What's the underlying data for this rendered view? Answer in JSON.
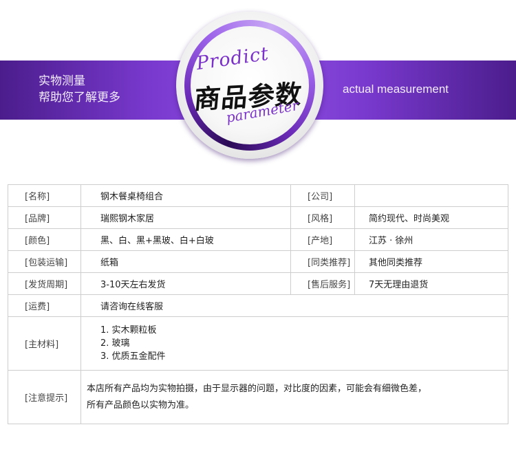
{
  "banner": {
    "left_line1": "实物测量",
    "left_line2": "帮助您了解更多",
    "right_text": "actual measurement",
    "badge_en_top": "Prodict",
    "badge_cn": "商品参数",
    "badge_en_bottom": "parameter"
  },
  "params": {
    "rows": [
      {
        "l1": "[名称]",
        "v1": "钢木餐桌椅组合",
        "l2": "[公司]",
        "v2": ""
      },
      {
        "l1": "[品牌]",
        "v1": "瑞熙钢木家居",
        "l2": "[风格]",
        "v2": "简约现代、时尚美观"
      },
      {
        "l1": "[颜色]",
        "v1": "黑、白、黑+黑玻、白+白玻",
        "l2": "[产地]",
        "v2": "江苏 · 徐州"
      },
      {
        "l1": "[包装运输]",
        "v1": "纸箱",
        "l2": "[同类推荐]",
        "v2": "其他同类推荐"
      },
      {
        "l1": "[发货周期]",
        "v1": "3-10天左右发货",
        "l2": "[售后服务]",
        "v2": "7天无理由退货"
      }
    ],
    "shipping": {
      "label": "[运费]",
      "value": "请咨询在线客服"
    },
    "material": {
      "label": "[主材料]",
      "items": [
        "1. 实木颗粒板",
        "2. 玻璃",
        "3. 优质五金配件"
      ]
    },
    "notice": {
      "label": "[注意提示]",
      "line1": "本店所有产品均为实物拍摄，由于显示器的问题，对比度的因素，可能会有细微色差，",
      "line2": "所有产品颜色以实物为准。"
    }
  },
  "colors": {
    "band": "#7a3ad0",
    "accent_text": "#7a32c9",
    "notice_text": "#48a020",
    "border": "#cdcdcd"
  }
}
